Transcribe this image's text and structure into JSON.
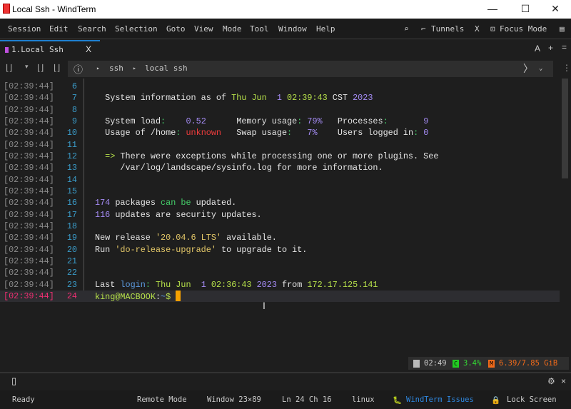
{
  "window": {
    "title": "Local Ssh - WindTerm",
    "minimize": "—",
    "maximize": "☐",
    "close": "✕"
  },
  "menu": [
    "Session",
    "Edit",
    "Search",
    "Selection",
    "Goto",
    "View",
    "Mode",
    "Tool",
    "Window",
    "Help"
  ],
  "menu_right": {
    "tunnels": "Tunnels",
    "x": "X",
    "focus": "Focus Mode"
  },
  "tab": {
    "label": "1.Local Ssh",
    "close": "X",
    "font_btn": "A",
    "add_btn": "+",
    "menu_btn": "="
  },
  "breadcrumb": [
    "ssh",
    "local ssh"
  ],
  "colors": {
    "w": "#e6e6e6",
    "g": "#b6e04a",
    "p": "#a58cf5",
    "r": "#f03c3c",
    "n": "#45d06a",
    "y": "#e3c768",
    "b": "#5c9be0",
    "accent": "#1e7fd0",
    "cursor": "#f5a000"
  },
  "terminal": {
    "lines": [
      {
        "ts": "[02:39:44]",
        "n": "6",
        "seg": []
      },
      {
        "ts": "[02:39:44]",
        "n": "7",
        "seg": [
          [
            "  System information as of ",
            "w"
          ],
          [
            "Thu Jun  ",
            "g"
          ],
          [
            "1",
            "p"
          ],
          [
            " 02:39:43 ",
            "g"
          ],
          [
            "CST ",
            "w"
          ],
          [
            "2023",
            "p"
          ]
        ]
      },
      {
        "ts": "[02:39:44]",
        "n": "8",
        "seg": []
      },
      {
        "ts": "[02:39:44]",
        "n": "9",
        "seg": [
          [
            "  System load",
            "w"
          ],
          [
            ":",
            "n"
          ],
          [
            "    ",
            "w"
          ],
          [
            "0.52",
            "p"
          ],
          [
            "      Memory usage",
            "w"
          ],
          [
            ": ",
            "n"
          ],
          [
            "79%",
            "p"
          ],
          [
            "   Processes",
            "w"
          ],
          [
            ":",
            "n"
          ],
          [
            "       ",
            "w"
          ],
          [
            "9",
            "p"
          ]
        ]
      },
      {
        "ts": "[02:39:44]",
        "n": "10",
        "seg": [
          [
            "  Usage of /home",
            "w"
          ],
          [
            ": ",
            "n"
          ],
          [
            "unknown",
            "r"
          ],
          [
            "   Swap usage",
            "w"
          ],
          [
            ":",
            "n"
          ],
          [
            "   ",
            "w"
          ],
          [
            "7%",
            "p"
          ],
          [
            "    Users logged in",
            "w"
          ],
          [
            ": ",
            "n"
          ],
          [
            "0",
            "p"
          ]
        ]
      },
      {
        "ts": "[02:39:44]",
        "n": "11",
        "seg": []
      },
      {
        "ts": "[02:39:44]",
        "n": "12",
        "seg": [
          [
            "  => ",
            "g"
          ],
          [
            "There were exceptions while processing one or more plugins. See",
            "w"
          ]
        ]
      },
      {
        "ts": "[02:39:44]",
        "n": "13",
        "seg": [
          [
            "     /var/log/landscape/sysinfo.log for more information.",
            "w"
          ]
        ]
      },
      {
        "ts": "[02:39:44]",
        "n": "14",
        "seg": []
      },
      {
        "ts": "[02:39:44]",
        "n": "15",
        "seg": []
      },
      {
        "ts": "[02:39:44]",
        "n": "16",
        "seg": [
          [
            "174",
            "p"
          ],
          [
            " packages ",
            "w"
          ],
          [
            "can be",
            "n"
          ],
          [
            " updated.",
            "w"
          ]
        ]
      },
      {
        "ts": "[02:39:44]",
        "n": "17",
        "seg": [
          [
            "116",
            "p"
          ],
          [
            " updates are security updates.",
            "w"
          ]
        ]
      },
      {
        "ts": "[02:39:44]",
        "n": "18",
        "seg": []
      },
      {
        "ts": "[02:39:44]",
        "n": "19",
        "seg": [
          [
            "New release ",
            "w"
          ],
          [
            "'20.04.6 LTS'",
            "y"
          ],
          [
            " available.",
            "w"
          ]
        ]
      },
      {
        "ts": "[02:39:44]",
        "n": "20",
        "seg": [
          [
            "Run ",
            "w"
          ],
          [
            "'do-release-upgrade'",
            "y"
          ],
          [
            " to upgrade to it.",
            "w"
          ]
        ]
      },
      {
        "ts": "[02:39:44]",
        "n": "21",
        "seg": []
      },
      {
        "ts": "[02:39:44]",
        "n": "22",
        "seg": []
      },
      {
        "ts": "[02:39:44]",
        "n": "23",
        "seg": [
          [
            "Last ",
            "w"
          ],
          [
            "login",
            "b"
          ],
          [
            ": ",
            "n"
          ],
          [
            "Thu Jun  ",
            "g"
          ],
          [
            "1",
            "p"
          ],
          [
            " 02:36:43 ",
            "g"
          ],
          [
            "2023",
            "p"
          ],
          [
            " from ",
            "w"
          ],
          [
            "172.17.125.141",
            "g"
          ]
        ]
      },
      {
        "ts": "[02:39:44]",
        "n": "24",
        "seg": [
          [
            "king@MACBOOK",
            "g"
          ],
          [
            ":",
            "w"
          ],
          [
            "~",
            "b"
          ],
          [
            "$ ",
            "g"
          ]
        ],
        "current": true
      }
    ]
  },
  "resources": {
    "time": "02:49",
    "cpu": "3.4%",
    "mem": "6.39/7.85 GiB",
    "cpu_badge": "C",
    "mem_badge": "M"
  },
  "status": {
    "ready": "Ready",
    "mode": "Remote Mode",
    "window": "Window 23×89",
    "pos": "Ln 24 Ch 16",
    "os": "linux",
    "issues": "WindTerm Issues",
    "lock": "Lock Screen"
  }
}
